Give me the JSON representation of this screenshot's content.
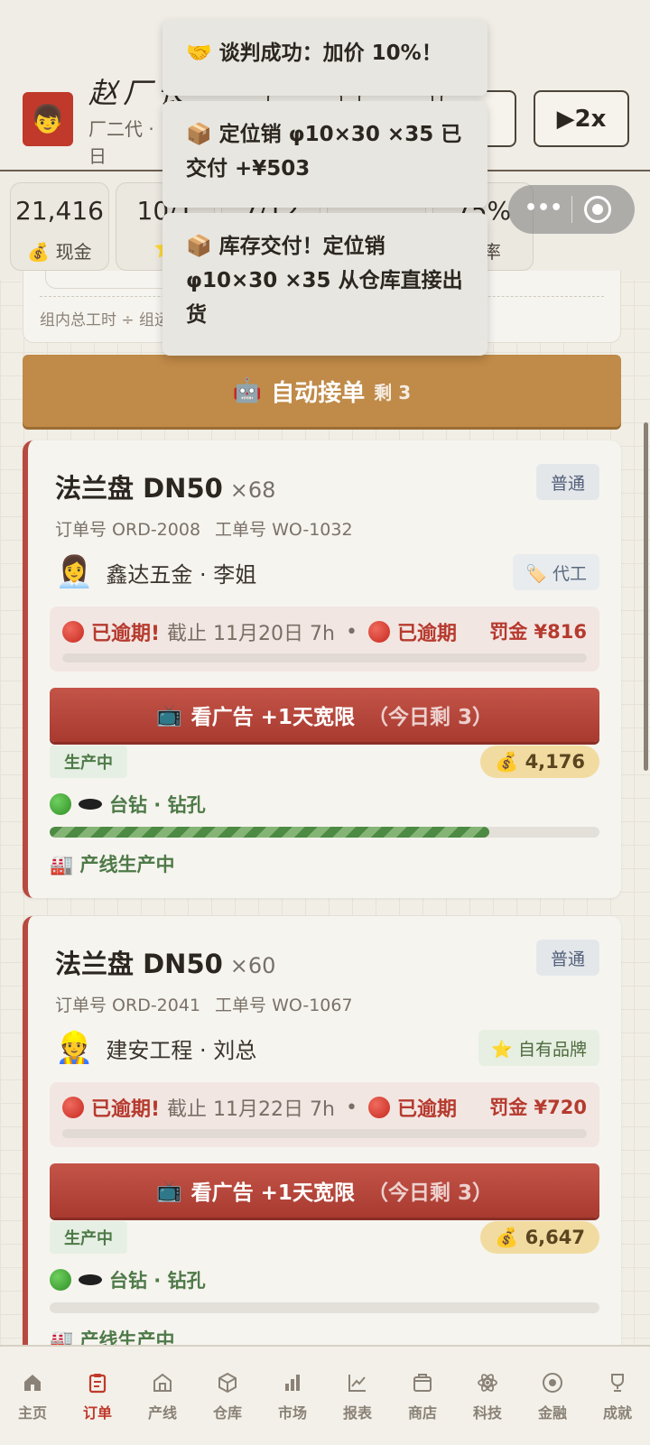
{
  "header": {
    "factory_name": "赵厂长",
    "factory_sub": "厂二代 · 日",
    "speed_label": "▶2x"
  },
  "stats": [
    {
      "value": "21,416",
      "label": "💰 现金"
    },
    {
      "value": "10/1",
      "label": "⭐"
    },
    {
      "value": "7/12",
      "label": ""
    },
    {
      "value": "",
      "label": ""
    },
    {
      "value": "75%",
      "label": "效率"
    }
  ],
  "info_card": {
    "note": "组内总工时 ÷ 组运"
  },
  "toasts": [
    "🤝 谈判成功：加价 10%！",
    "📦 定位销 φ10×30 ×35 已交付 +¥503",
    "📦 库存交付！定位销 φ10×30 ×35 从仓库直接出货"
  ],
  "auto_accept": {
    "label": "自动接单",
    "remaining": "剩 3",
    "icon": "robot-icon"
  },
  "orders": [
    {
      "title": "法兰盘 DN50",
      "qty": "×68",
      "tag": "普通",
      "order_no": "订单号 ORD-2008",
      "work_no": "工单号 WO-1032",
      "client_face": "👩‍💼",
      "client": "鑫达五金 · 李姐",
      "badge": "🏷️ 代工",
      "overdue_label": "已逾期!",
      "deadline": "截止 11月20日 7h",
      "overdue_label2": "已逾期",
      "penalty": "罚金 ¥816",
      "ad_label": "看广告 +1天宽限",
      "ad_sub": "（今日剩 3）",
      "status": "生产中",
      "money": "💰 4,176",
      "machine": "台钻 · 钻孔",
      "progress": 0.8,
      "line_status": "🏭 产线生产中"
    },
    {
      "title": "法兰盘 DN50",
      "qty": "×60",
      "tag": "普通",
      "order_no": "订单号 ORD-2041",
      "work_no": "工单号 WO-1067",
      "client_face": "👷",
      "client": "建安工程 · 刘总",
      "badge": "⭐ 自有品牌",
      "overdue_label": "已逾期!",
      "deadline": "截止 11月22日 7h",
      "overdue_label2": "已逾期",
      "penalty": "罚金 ¥720",
      "ad_label": "看广告 +1天宽限",
      "ad_sub": "（今日剩 3）",
      "status": "生产中",
      "money": "💰 6,647",
      "machine": "台钻 · 钻孔",
      "progress": 0.0,
      "line_status": "🏭 产线生产中"
    }
  ],
  "nav": [
    {
      "label": "主页",
      "icon": "home-icon"
    },
    {
      "label": "订单",
      "icon": "orders-icon",
      "active": true
    },
    {
      "label": "产线",
      "icon": "factory-icon"
    },
    {
      "label": "仓库",
      "icon": "box-icon"
    },
    {
      "label": "市场",
      "icon": "bar-chart-icon"
    },
    {
      "label": "报表",
      "icon": "line-chart-icon"
    },
    {
      "label": "商店",
      "icon": "shop-icon"
    },
    {
      "label": "科技",
      "icon": "atom-icon"
    },
    {
      "label": "金融",
      "icon": "coin-icon"
    },
    {
      "label": "成就",
      "icon": "trophy-icon"
    }
  ]
}
